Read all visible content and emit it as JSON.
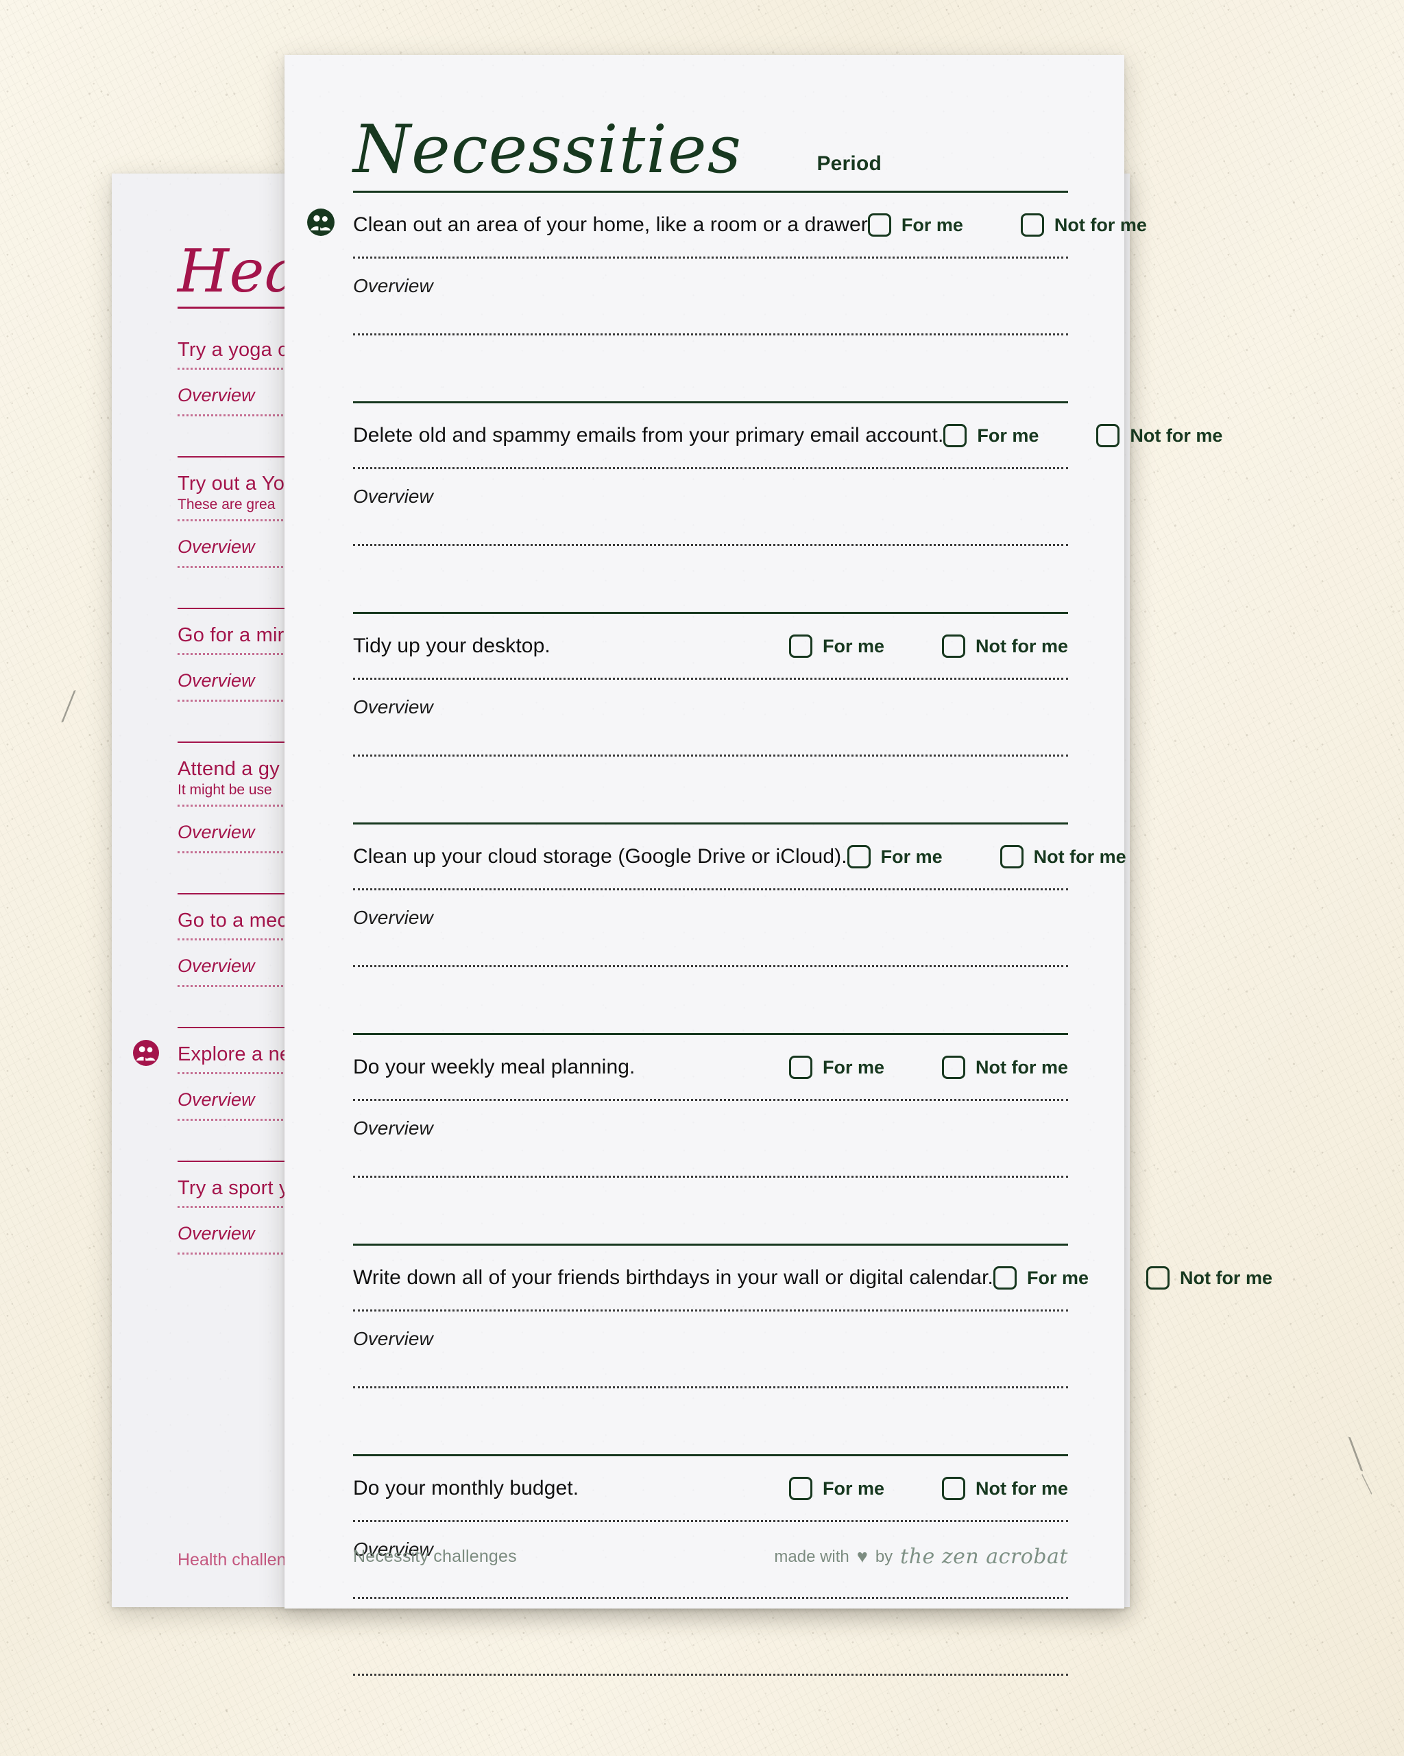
{
  "colors": {
    "backdrop": "#f8f3e5",
    "sheet_front": "#f6f6f8",
    "sheet_back": "#f1f1f4",
    "green_accent": "#17381f",
    "crimson_accent": "#a4144b",
    "footer_sage": "#7c8c80",
    "footer_pink": "#c4577f",
    "body_text": "#101010"
  },
  "front_sheet": {
    "title": "Necessities",
    "column_header": "Period",
    "overview_label": "Overview",
    "checkbox_labels": {
      "yes": "For me",
      "no": "Not for me"
    },
    "icons": {
      "people": "people-group-icon",
      "heart": "♥"
    },
    "rows": [
      {
        "task": "Clean out an area of your home, like a room or a drawer",
        "has_icon": true,
        "last": false
      },
      {
        "task": "Delete old and spammy emails from your primary email account.",
        "has_icon": false,
        "last": false
      },
      {
        "task": "Tidy up your desktop.",
        "has_icon": false,
        "last": false
      },
      {
        "task": "Clean up your cloud storage (Google Drive or iCloud).",
        "has_icon": false,
        "last": false
      },
      {
        "task": "Do your weekly meal planning.",
        "has_icon": false,
        "last": false
      },
      {
        "task": "Write down all of your friends birthdays in your wall or digital calendar.",
        "has_icon": false,
        "last": false
      },
      {
        "task": "Do your monthly budget.",
        "has_icon": false,
        "last": true
      }
    ],
    "footer": {
      "page_label": "Necessity challenges",
      "made_with": "made with",
      "by": "by",
      "brand": "the zen acrobat"
    }
  },
  "back_sheet": {
    "title": "Hea",
    "overview_label": "Overview",
    "rows": [
      {
        "task": "Try a yoga c",
        "sub": "",
        "has_icon": false
      },
      {
        "task": "Try out a Yo",
        "sub": "These are grea",
        "has_icon": false
      },
      {
        "task": "Go for a mir",
        "sub": "",
        "has_icon": false
      },
      {
        "task": "Attend a gy",
        "sub": "It might be use",
        "has_icon": false
      },
      {
        "task": "Go to a mec",
        "sub": "",
        "has_icon": false
      },
      {
        "task": "Explore a ne",
        "sub": "",
        "has_icon": true
      },
      {
        "task": "Try a sport y",
        "sub": "",
        "has_icon": false
      }
    ],
    "footer": {
      "page_label": "Health challenges",
      "made_with": "made with",
      "by": "by",
      "brand": "the zen acrobat"
    }
  }
}
